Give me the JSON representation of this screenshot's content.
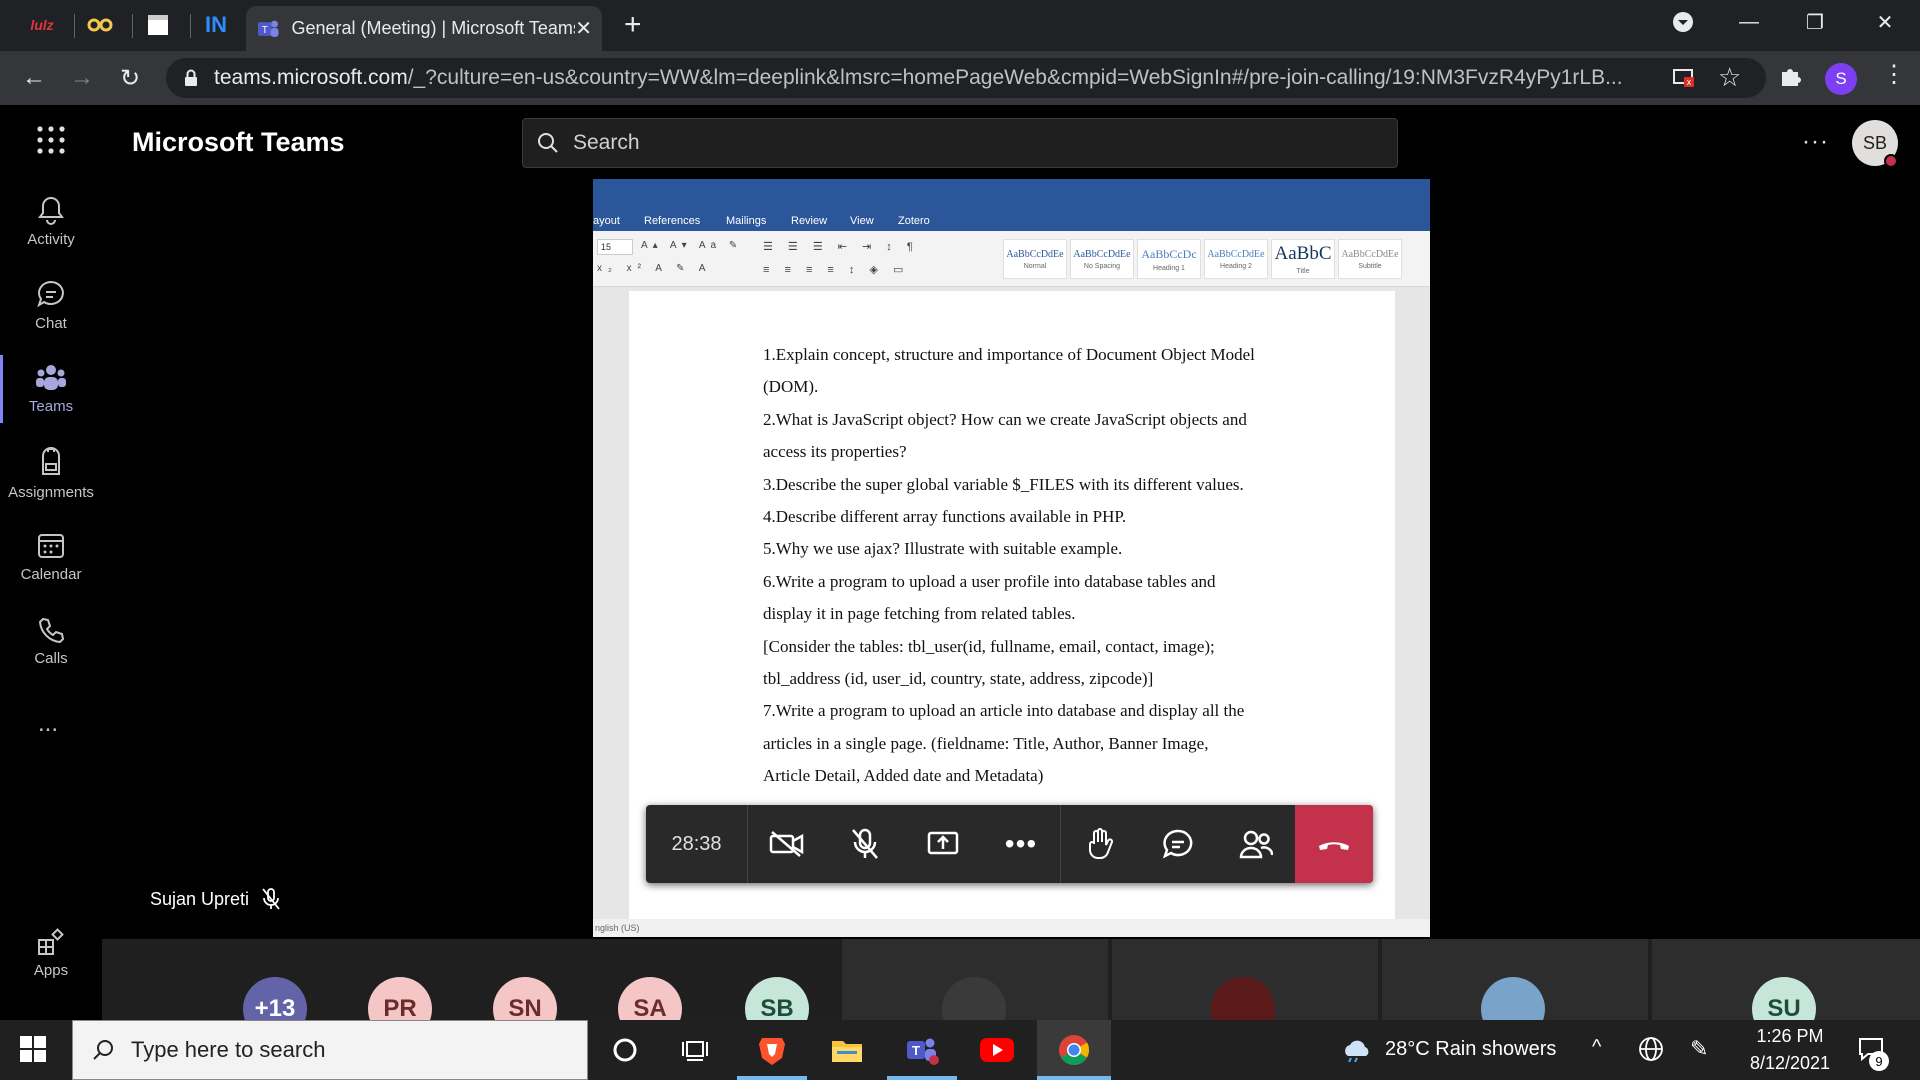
{
  "browser": {
    "tabs": [
      {
        "icon": "lulz-icon",
        "label": "lulz"
      },
      {
        "icon": "glasses-icon",
        "label": ""
      },
      {
        "icon": "window-icon",
        "label": ""
      },
      {
        "icon": "linkedin-icon",
        "label": "IN"
      }
    ],
    "active_tab_title": "General (Meeting) | Microsoft Teams",
    "url_host": "teams.microsoft.com",
    "url_path": "/_?culture=en-us&country=WW&lm=deeplink&lmsrc=homePageWeb&cmpid=WebSignIn#/pre-join-calling/19:NM3FvzR4yPy1rLB...",
    "profile_initial": "S",
    "new_tab_label": "+"
  },
  "teams": {
    "app_title": "Microsoft Teams",
    "search_placeholder": "Search",
    "user_initials": "SB",
    "rail": [
      {
        "label": "Activity",
        "icon": "bell-icon"
      },
      {
        "label": "Chat",
        "icon": "chat-icon"
      },
      {
        "label": "Teams",
        "icon": "teams-icon",
        "active": true
      },
      {
        "label": "Assignments",
        "icon": "backpack-icon"
      },
      {
        "label": "Calendar",
        "icon": "calendar-icon"
      },
      {
        "label": "Calls",
        "icon": "phone-icon"
      }
    ],
    "more_label": "...",
    "apps_label": "Apps"
  },
  "shared_doc": {
    "ribbon_tabs": [
      "ayout",
      "References",
      "Mailings",
      "Review",
      "View",
      "Zotero"
    ],
    "font_size": "15",
    "styles": [
      {
        "sample": "AaBbCcDdEe",
        "name": "Normal"
      },
      {
        "sample": "AaBbCcDdEe",
        "name": "No Spacing"
      },
      {
        "sample": "AaBbCcDc",
        "name": "Heading 1"
      },
      {
        "sample": "AaBbCcDdEe",
        "name": "Heading 2"
      },
      {
        "sample": "AaBbC",
        "name": "Title"
      },
      {
        "sample": "AaBbCcDdEe",
        "name": "Subtitle"
      }
    ],
    "lines": [
      "1.Explain concept, structure and importance of Document Object Model",
      "(DOM).",
      "2.What is JavaScript object? How can we create JavaScript objects and",
      "access its properties?",
      "3.Describe the super global variable $_FILES with its different values.",
      "4.Describe different array functions available in PHP.",
      "5.Why we use ajax? Illustrate with suitable example.",
      "6.Write a program to upload a user profile into database tables and",
      "display it in page fetching from related tables.",
      "[Consider the tables: tbl_user(id, fullname, email, contact, image);",
      "tbl_address (id, user_id, country, state, address, zipcode)]",
      "7.Write a program to upload an article into database and display all the",
      "articles in a single page. (fieldname: Title, Author, Banner Image,",
      "Article Detail, Added date and Metadata)"
    ],
    "status_lang": "nglish (US)"
  },
  "call": {
    "timer": "28:38",
    "presenter_name": "Sujan Upreti",
    "participants": [
      {
        "initials": "+13",
        "color": "#6264a7",
        "text_color": "#ffffff"
      },
      {
        "initials": "PR",
        "color": "#f5c6c6",
        "text_color": "#6b2c2c"
      },
      {
        "initials": "SN",
        "color": "#f5c6c6",
        "text_color": "#6b2c2c"
      },
      {
        "initials": "SA",
        "color": "#f5c6c6",
        "text_color": "#6b2c2c"
      },
      {
        "initials": "SB",
        "color": "#c6e6d9",
        "text_color": "#1e4d3b"
      },
      {
        "initials": "SU",
        "color": "#c6e6d9",
        "text_color": "#1e4d3b"
      }
    ]
  },
  "taskbar": {
    "search_placeholder": "Type here to search",
    "weather": "28°C  Rain showers",
    "time": "1:26 PM",
    "date": "8/12/2021",
    "notification_count": "9"
  },
  "colors": {
    "teams_accent": "#6264a7",
    "hangup": "#c4314b",
    "word_blue": "#2b579a"
  }
}
